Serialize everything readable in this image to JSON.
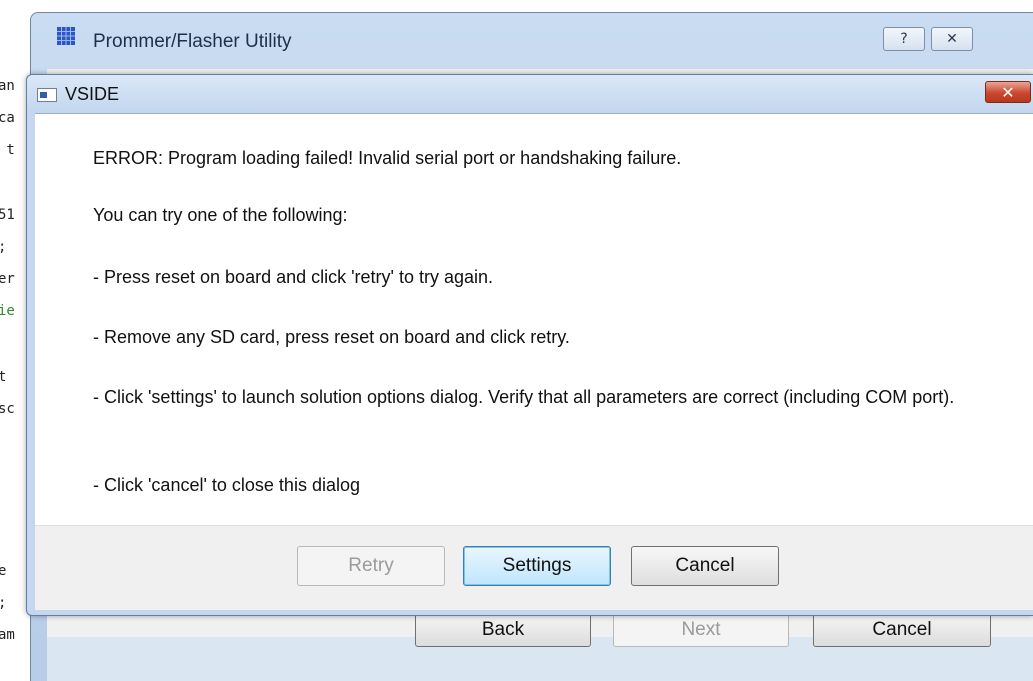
{
  "background_editor": {
    "lines": [
      {
        "text": "an",
        "color": "dark"
      },
      {
        "text": "ca",
        "color": "dark"
      },
      {
        "text": " t",
        "color": "dark"
      },
      {
        "text": "51",
        "color": "dark"
      },
      {
        "text": ";",
        "color": "dark"
      },
      {
        "text": "er",
        "color": "dark"
      },
      {
        "text": "ie",
        "color": "green"
      },
      {
        "text": "t",
        "color": "dark"
      },
      {
        "text": "sc",
        "color": "dark"
      },
      {
        "text": "e",
        "color": "dark"
      },
      {
        "text": ";",
        "color": "dark"
      },
      {
        "text": "am",
        "color": "dark"
      }
    ]
  },
  "back_window": {
    "title": "Prommer/Flasher Utility",
    "help_button": "?",
    "close_button": "✕",
    "buttons": {
      "back": "Back",
      "next": "Next",
      "cancel": "Cancel"
    }
  },
  "dialog": {
    "title": "VSIDE",
    "close_glyph": "✕",
    "messages": [
      "ERROR: Program loading failed! Invalid serial port or handshaking failure.",
      "You can try one of the following:",
      "- Press reset on board and click 'retry' to try again.",
      "- Remove any SD card, press reset on board and click retry.",
      "- Click 'settings' to launch solution options dialog. Verify that all parameters are correct (including COM port).",
      "- Click 'cancel' to close this dialog"
    ],
    "buttons": {
      "retry": "Retry",
      "settings": "Settings",
      "cancel": "Cancel"
    }
  },
  "colors": {
    "titlebar": "#c4d7ee",
    "close_button": "#c9482f",
    "default_button": "#bee6fd"
  }
}
